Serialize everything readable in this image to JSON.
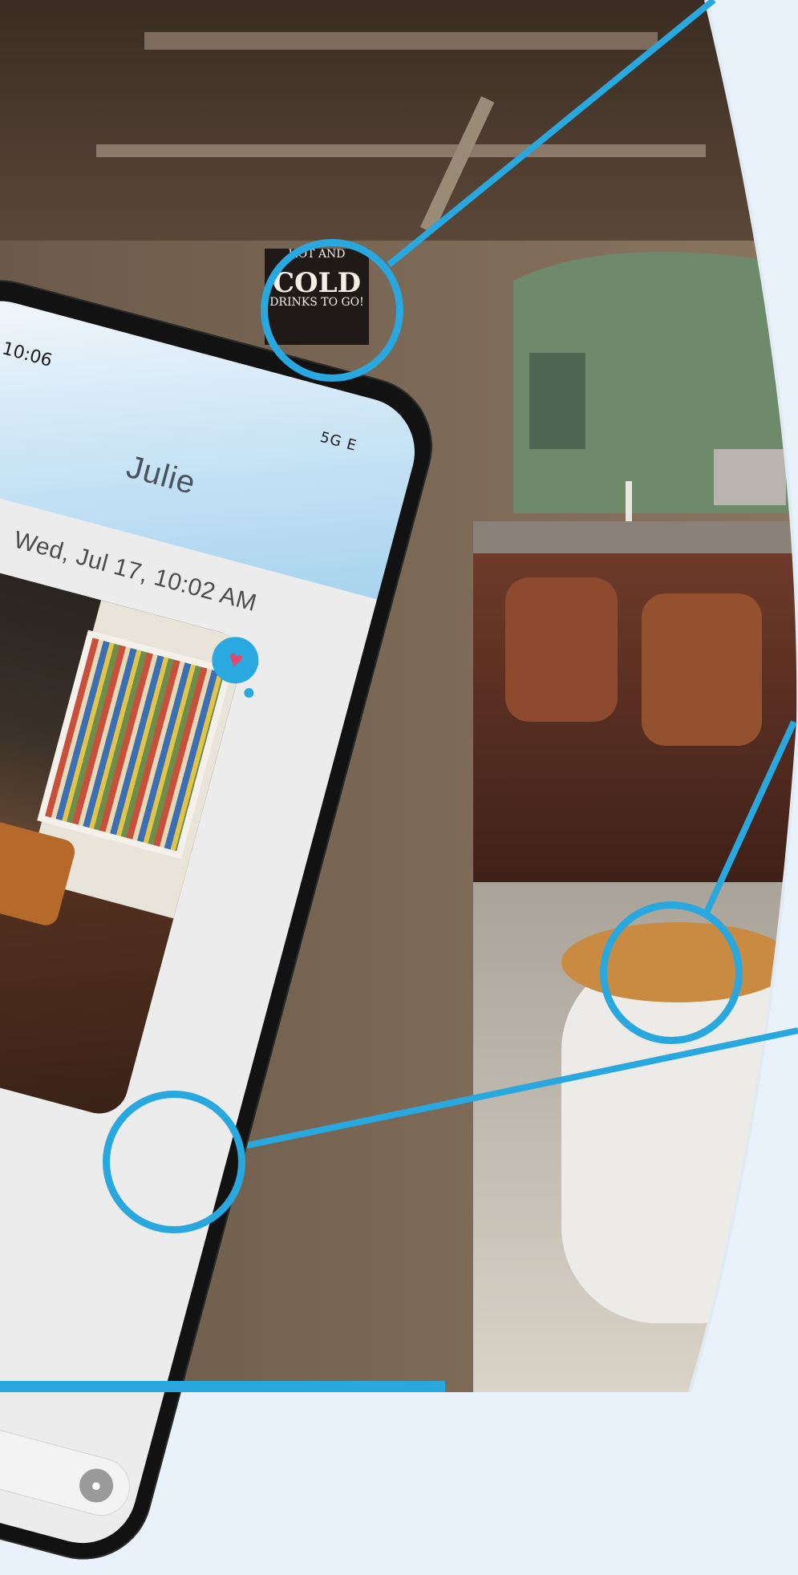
{
  "phone": {
    "status_time": "10:06",
    "status_network": "5G E",
    "contact_name": "Julie",
    "message_timestamp": "Wed, Jul 17, 10:02 AM"
  },
  "sign": {
    "line1": "HOT AND",
    "line2": "COLD",
    "line3": "DRINKS TO GO!"
  },
  "colors": {
    "callout_accent": "#29a7df",
    "page_background": "#e9f2fa"
  },
  "icons": {
    "back": "back-chevron-icon",
    "reaction": "heart-icon",
    "mic": "mic-icon"
  }
}
